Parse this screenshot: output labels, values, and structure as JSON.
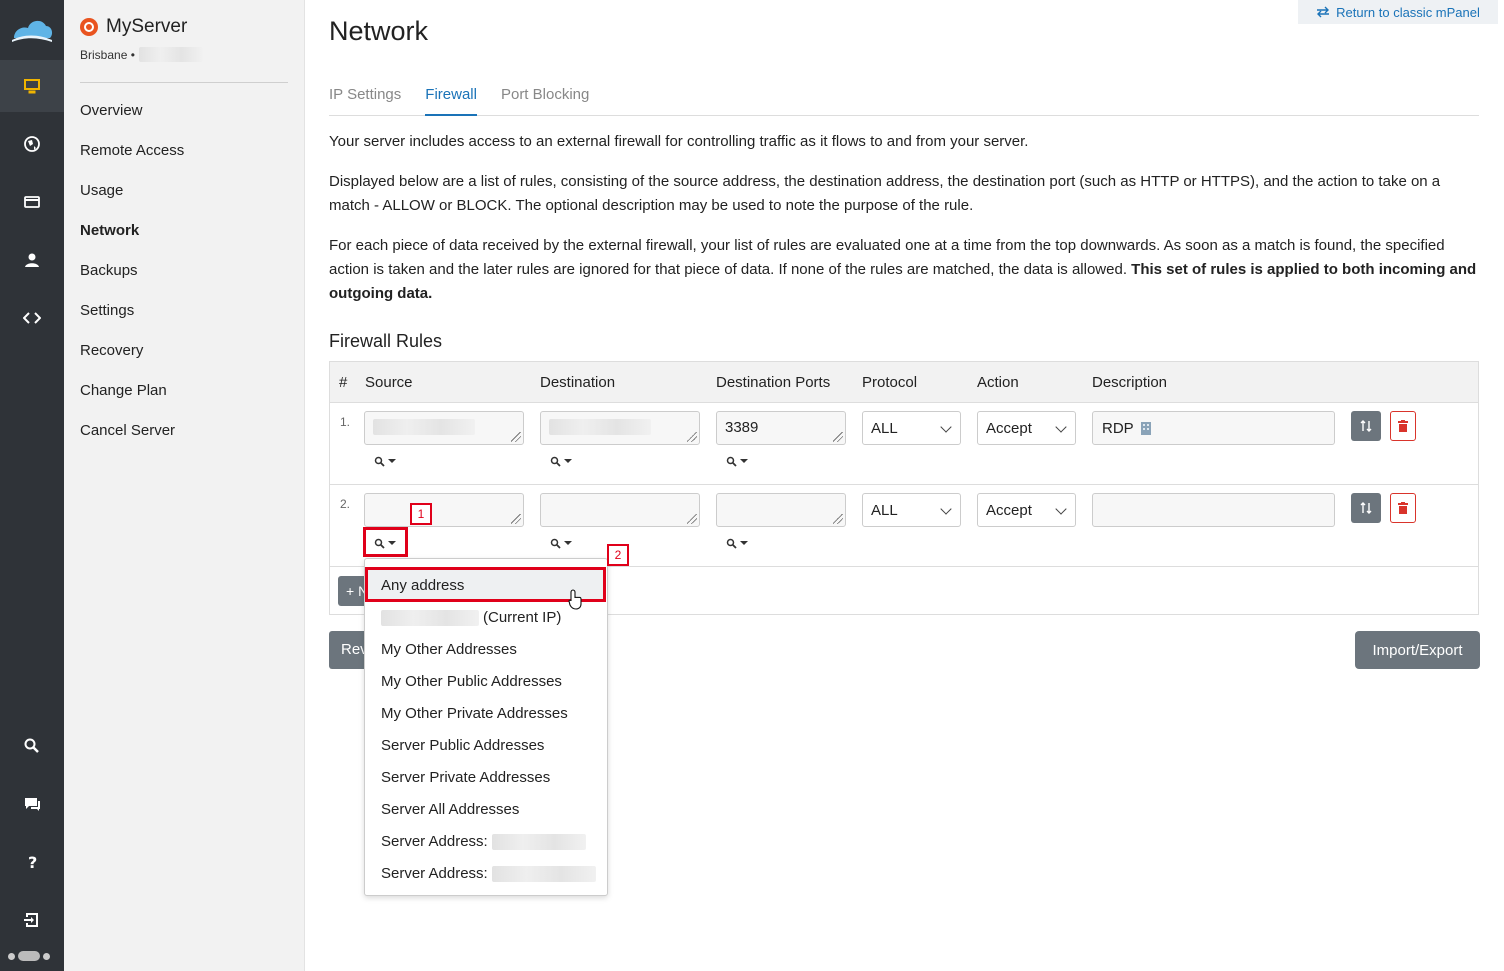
{
  "server": {
    "name": "MyServer",
    "location": "Brisbane •"
  },
  "nav": {
    "items": [
      {
        "label": "Overview",
        "active": false
      },
      {
        "label": "Remote Access",
        "active": false
      },
      {
        "label": "Usage",
        "active": false
      },
      {
        "label": "Network",
        "active": true
      },
      {
        "label": "Backups",
        "active": false
      },
      {
        "label": "Settings",
        "active": false
      },
      {
        "label": "Recovery",
        "active": false
      },
      {
        "label": "Change Plan",
        "active": false
      },
      {
        "label": "Cancel Server",
        "active": false
      }
    ]
  },
  "rail": {
    "top_icons": [
      "cloud-logo-icon",
      "monitor-icon",
      "globe-icon",
      "billing-card-icon",
      "user-icon",
      "code-icon"
    ],
    "bottom_icons": [
      "search-icon",
      "chat-icon",
      "help-icon",
      "logout-icon"
    ]
  },
  "header": {
    "classic_link": "Return to classic mPanel",
    "title": "Network"
  },
  "tabs": [
    {
      "label": "IP Settings",
      "active": false
    },
    {
      "label": "Firewall",
      "active": true
    },
    {
      "label": "Port Blocking",
      "active": false
    }
  ],
  "intro": {
    "p1": "Your server includes access to an external firewall for controlling traffic as it flows to and from your server.",
    "p2": "Displayed below are a list of rules, consisting of the source address, the destination address, the destination port (such as HTTP or HTTPS), and the action to take on a match - ALLOW or BLOCK. The optional description may be used to note the purpose of the rule.",
    "p3": "For each piece of data received by the external firewall, your list of rules are evaluated one at a time from the top downwards. As soon as a match is found, the specified action is taken and the later rules are ignored for that piece of data. If none of the rules are matched, the data is allowed.",
    "p3_bold": "This set of rules is applied to both incoming and outgoing data."
  },
  "firewall": {
    "section_title": "Firewall Rules",
    "columns": [
      "#",
      "Source",
      "Destination",
      "Destination Ports",
      "Protocol",
      "Action",
      "Description"
    ],
    "rows": [
      {
        "num": "1.",
        "source": "",
        "destination": "",
        "ports": "3389",
        "protocol": "ALL",
        "action": "Accept",
        "description": "RDP"
      },
      {
        "num": "2.",
        "source": "",
        "destination": "",
        "ports": "",
        "protocol": "ALL",
        "action": "Accept",
        "description": ""
      }
    ],
    "add_label": "+ N",
    "revert_label": "Rev",
    "import_label": "Import/Export"
  },
  "annotations": {
    "marker1": "1",
    "marker2": "2"
  },
  "dropdown": {
    "items": [
      "Any address",
      "(Current IP)",
      "My Other Addresses",
      "My Other Public Addresses",
      "My Other Private Addresses",
      "Server Public Addresses",
      "Server Private Addresses",
      "Server All Addresses",
      "Server Address:",
      "Server Address:"
    ]
  },
  "colors": {
    "accent": "#1a73b8",
    "rail_bg": "#2f3338",
    "active_icon": "#f0b400",
    "marker": "#e0001a",
    "button_gray": "#6c757d",
    "delete_red": "#d9342b"
  }
}
